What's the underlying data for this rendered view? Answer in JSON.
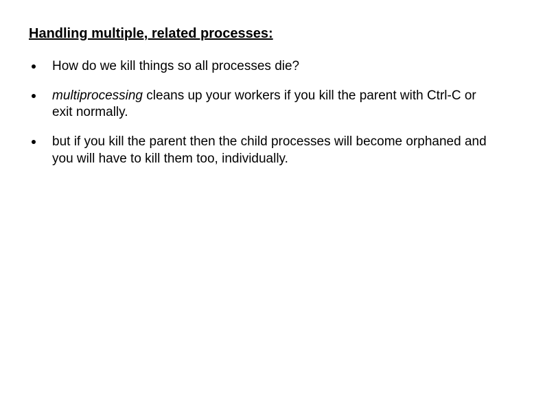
{
  "heading": "Handling multiple, related processes:",
  "bullets": [
    {
      "prefix_italic": "",
      "text": "How do we kill things so all processes die?"
    },
    {
      "prefix_italic": "multiprocessing",
      "text": " cleans up your workers if you kill the parent with Ctrl-C or exit normally."
    },
    {
      "prefix_italic": "",
      "text": "but if you kill the parent then the child processes will become orphaned and you will have to kill them too, individually."
    }
  ]
}
